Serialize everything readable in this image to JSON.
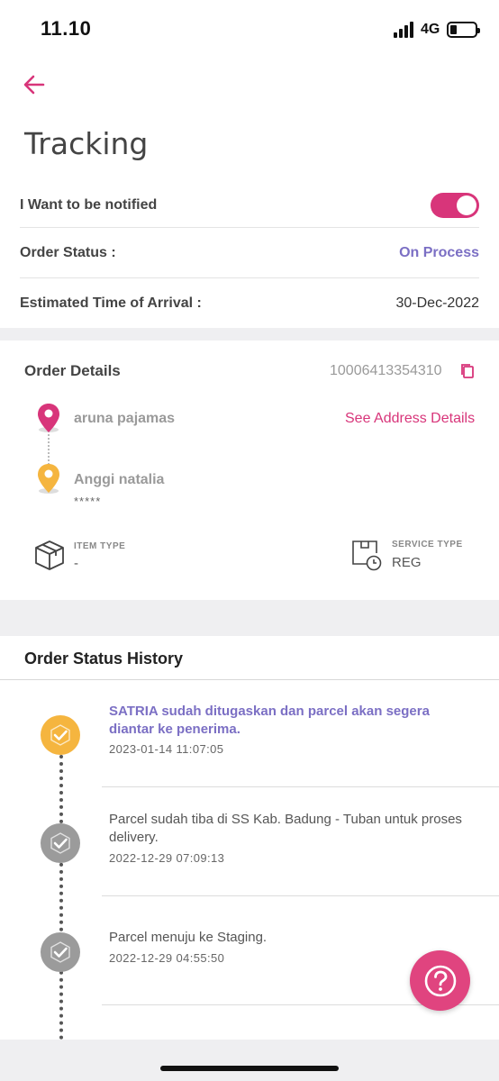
{
  "status_bar": {
    "time": "11.10",
    "network": "4G"
  },
  "header": {
    "title": "Tracking"
  },
  "notify": {
    "label": "I Want to be notified",
    "enabled": true
  },
  "order_status": {
    "label": "Order Status :",
    "value": "On Process"
  },
  "eta": {
    "label": "Estimated Time of Arrival :",
    "value": "30-Dec-2022"
  },
  "order_details": {
    "title": "Order Details",
    "number": "10006413354310",
    "sender": "aruna pajamas",
    "address_link": "See Address Details",
    "receiver": "Anggi natalia",
    "receiver_address": "*****",
    "item_type_label": "ITEM TYPE",
    "item_type_value": "-",
    "service_type_label": "SERVICE TYPE",
    "service_type_value": "REG"
  },
  "history": {
    "title": "Order Status History",
    "events": [
      {
        "text": "SATRIA sudah ditugaskan dan parcel akan segera diantar ke penerima.",
        "time": "2023-01-14 11:07:05",
        "active": true
      },
      {
        "text": "Parcel sudah tiba di SS Kab. Badung - Tuban untuk proses delivery.",
        "time": "2022-12-29 07:09:13",
        "active": false
      },
      {
        "text": "Parcel menuju ke Staging.",
        "time": "2022-12-29 04:55:50",
        "active": false
      }
    ]
  },
  "colors": {
    "accent": "#d8357a",
    "status": "#7b6fc4",
    "active_dot": "#f5b53f",
    "done_dot": "#9b9b9b"
  },
  "icons": {
    "back": "arrow-left-icon",
    "copy": "copy-icon",
    "help": "question-icon"
  }
}
